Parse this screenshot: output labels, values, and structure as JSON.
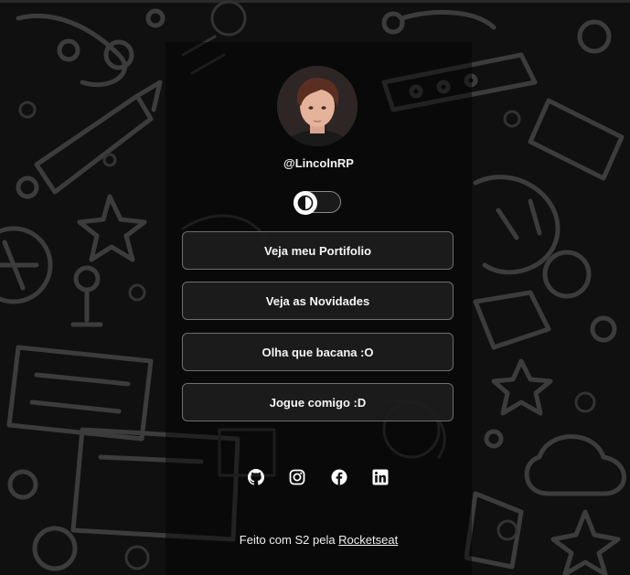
{
  "profile": {
    "username": "@LincolnRP",
    "avatar_alt": "profile photo"
  },
  "theme_toggle": {
    "state": "dark",
    "icon": "half-circle-contrast-icon"
  },
  "links": [
    {
      "label": "Veja meu Portifolio"
    },
    {
      "label": "Veja as Novidades"
    },
    {
      "label": "Olha que bacana :O"
    },
    {
      "label": "Jogue comigo :D"
    }
  ],
  "socials": [
    {
      "icon": "github-icon"
    },
    {
      "icon": "instagram-icon"
    },
    {
      "icon": "facebook-icon"
    },
    {
      "icon": "linkedin-icon"
    }
  ],
  "footer": {
    "prefix": "Feito com S2 pela ",
    "link": "Rocketseat"
  },
  "colors": {
    "background": "#101010",
    "button_bg": "#1e1e1e",
    "button_border": "#6e6e6e",
    "text": "#ffffff"
  }
}
